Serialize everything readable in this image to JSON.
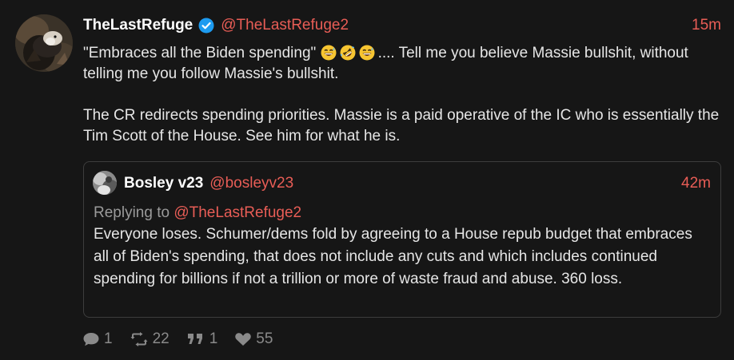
{
  "post": {
    "display_name": "TheLastRefuge",
    "verified": true,
    "handle": "@TheLastRefuge2",
    "time": "15m",
    "text_part1": "\"Embraces all the Biden spending\"",
    "emojis": [
      "grinning-sweat-emoji",
      "rolling-laughing-emoji",
      "grinning-sweat-emoji"
    ],
    "text_part2": ".... Tell me you believe Massie bullshit, without telling me you follow Massie's bullshit.",
    "paragraph2": "The CR redirects spending priorities.  Massie is a paid operative of the IC who is essentially the Tim Scott of the House. See him for what he is."
  },
  "quote": {
    "display_name": "Bosley v23",
    "handle": "@bosleyv23",
    "time": "42m",
    "replying_prefix": "Replying to",
    "replying_to": "@TheLastRefuge2",
    "text": "Everyone loses. Schumer/dems fold by agreeing to a House repub budget that embraces all of Biden's spending, that does not include any cuts and which includes continued spending for billions if not a trillion or more of waste fraud and abuse.  360 loss."
  },
  "actions": {
    "replies": "1",
    "reposts": "22",
    "quotes": "1",
    "likes": "55"
  },
  "colors": {
    "background": "#161616",
    "accent": "#e85d56",
    "verified": "#1d9bf0",
    "muted": "#8a8a8a"
  }
}
